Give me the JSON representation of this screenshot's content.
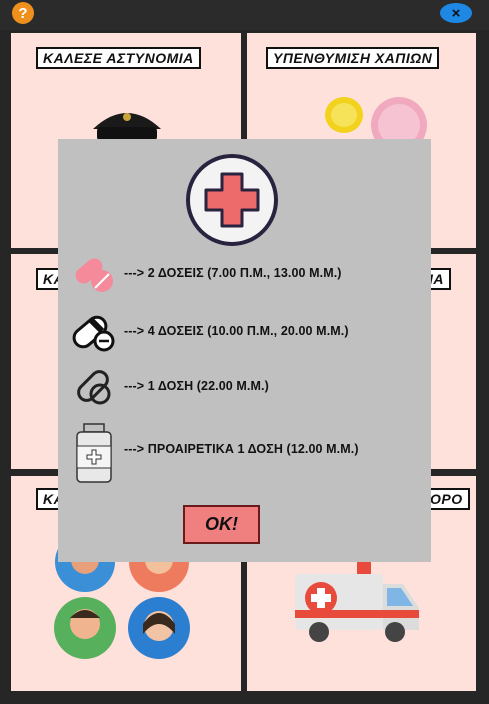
{
  "topbar": {
    "help_label": "?",
    "close_label": "×"
  },
  "tiles": [
    {
      "label": "ΚΑΛΕΣΕ ΑΣΤΥΝΟΜΙΑ"
    },
    {
      "label": "ΥΠΕΝΘΥΜΙΣΗ ΧΑΠΙΩΝ"
    },
    {
      "label": "ΚΑ"
    },
    {
      "label": "ΙΑ"
    },
    {
      "label": "ΚΑ"
    },
    {
      "label": "ΟΡΟ"
    }
  ],
  "modal": {
    "icon": "medical-cross-icon",
    "rows": [
      {
        "icon": "pink-pills-icon",
        "text": "---> 2 ΔΟΣΕΙΣ (7.00 Π.Μ., 13.00 Μ.Μ.)"
      },
      {
        "icon": "capsule-minus-icon",
        "text": "---> 4 ΔΟΣΕΙΣ (10.00 Π.Μ., 20.00 Μ.Μ.)"
      },
      {
        "icon": "pill-outline-icon",
        "text": "---> 1 ΔΟΣΗ (22.00 Μ.Μ.)"
      },
      {
        "icon": "medicine-bottle-icon",
        "text": "---> ΠΡΟΑΙΡΕΤΙΚΑ 1 ΔΟΣΗ (12.00 Μ.Μ.)"
      }
    ],
    "ok_label": "OK!"
  }
}
